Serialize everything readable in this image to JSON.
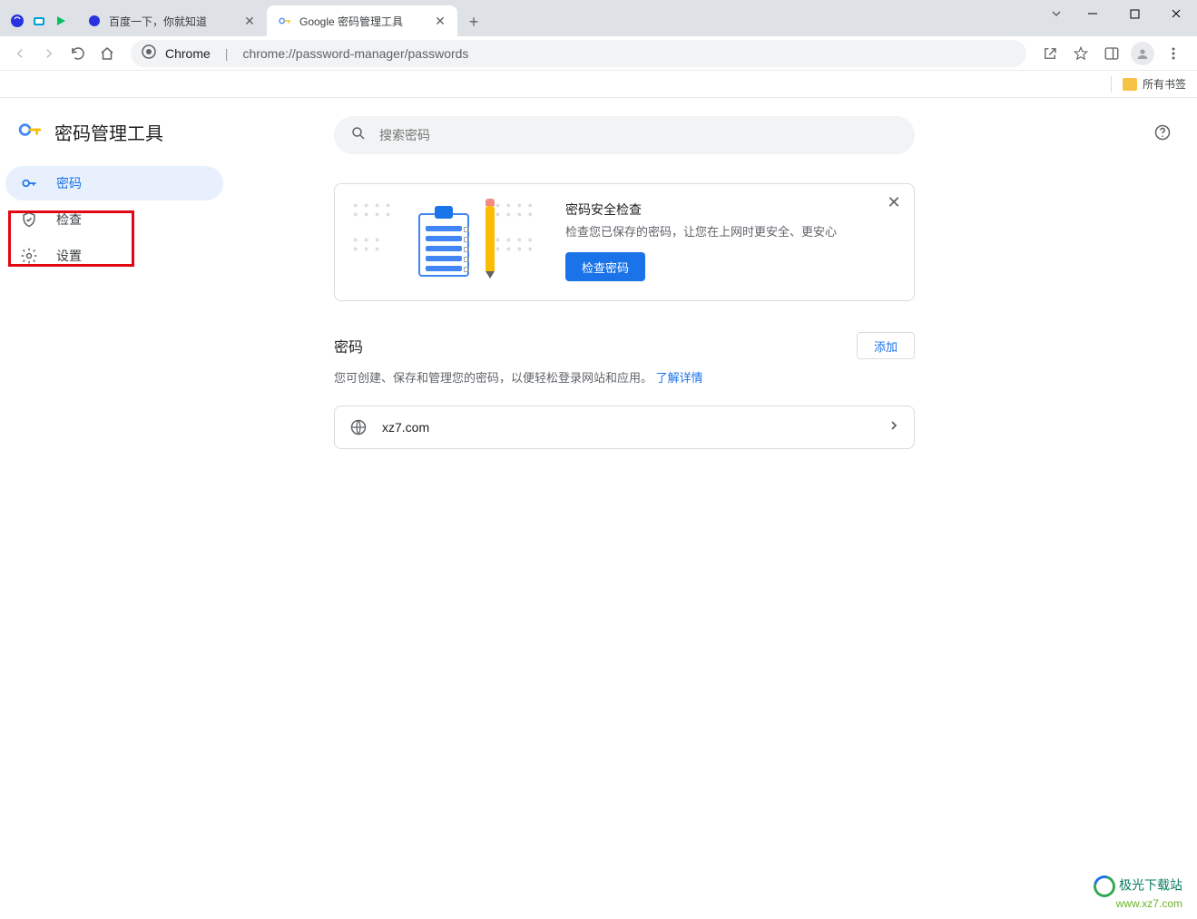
{
  "window": {
    "tabs": [
      {
        "title": "百度一下，你就知道"
      },
      {
        "title": "Google 密码管理工具"
      }
    ]
  },
  "addressbar": {
    "origin_label": "Chrome",
    "url": "chrome://password-manager/passwords"
  },
  "bookmarkbar": {
    "all_bookmarks": "所有书签"
  },
  "sidebar": {
    "app_title": "密码管理工具",
    "items": [
      {
        "label": "密码"
      },
      {
        "label": "检查"
      },
      {
        "label": "设置"
      }
    ]
  },
  "main": {
    "search_placeholder": "搜索密码",
    "checkup_card": {
      "title": "密码安全检查",
      "description": "检查您已保存的密码，让您在上网时更安全、更安心",
      "button": "检查密码"
    },
    "passwords_section": {
      "title": "密码",
      "add_button": "添加",
      "description": "您可创建、保存和管理您的密码，以便轻松登录网站和应用。",
      "learn_more": "了解详情"
    },
    "password_entries": [
      {
        "domain": "xz7.com"
      }
    ]
  },
  "watermark": {
    "line1": "极光下载站",
    "line2": "www.xz7.com"
  }
}
